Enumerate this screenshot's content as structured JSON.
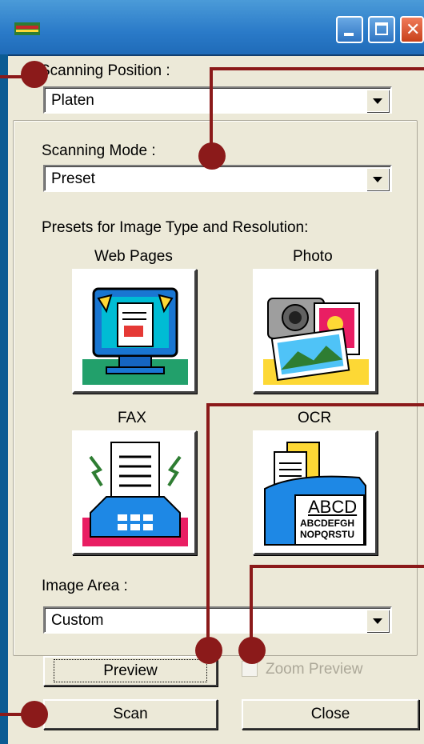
{
  "window": {
    "title": ""
  },
  "scanning_position": {
    "label": "Scanning Position :",
    "value": "Platen"
  },
  "scanning_mode": {
    "label": "Scanning Mode :",
    "value": "Preset"
  },
  "presets": {
    "heading": "Presets for Image Type and Resolution:",
    "items": [
      {
        "label": "Web Pages",
        "icon": "web-pages-icon"
      },
      {
        "label": "Photo",
        "icon": "photo-icon"
      },
      {
        "label": "FAX",
        "icon": "fax-icon"
      },
      {
        "label": "OCR",
        "icon": "ocr-icon"
      }
    ],
    "ocr_sample_big": "ABCD",
    "ocr_sample_line1": "ABCDEFGH",
    "ocr_sample_line2": "NOPQRSTU"
  },
  "image_area": {
    "label": "Image Area :",
    "value": "Custom"
  },
  "buttons": {
    "preview": "Preview",
    "zoom_preview": "Zoom Preview",
    "scan": "Scan",
    "close": "Close"
  },
  "colors": {
    "accent": "#0b5b93",
    "callout": "#8b1a1a",
    "dialog": "#ece9d8"
  }
}
